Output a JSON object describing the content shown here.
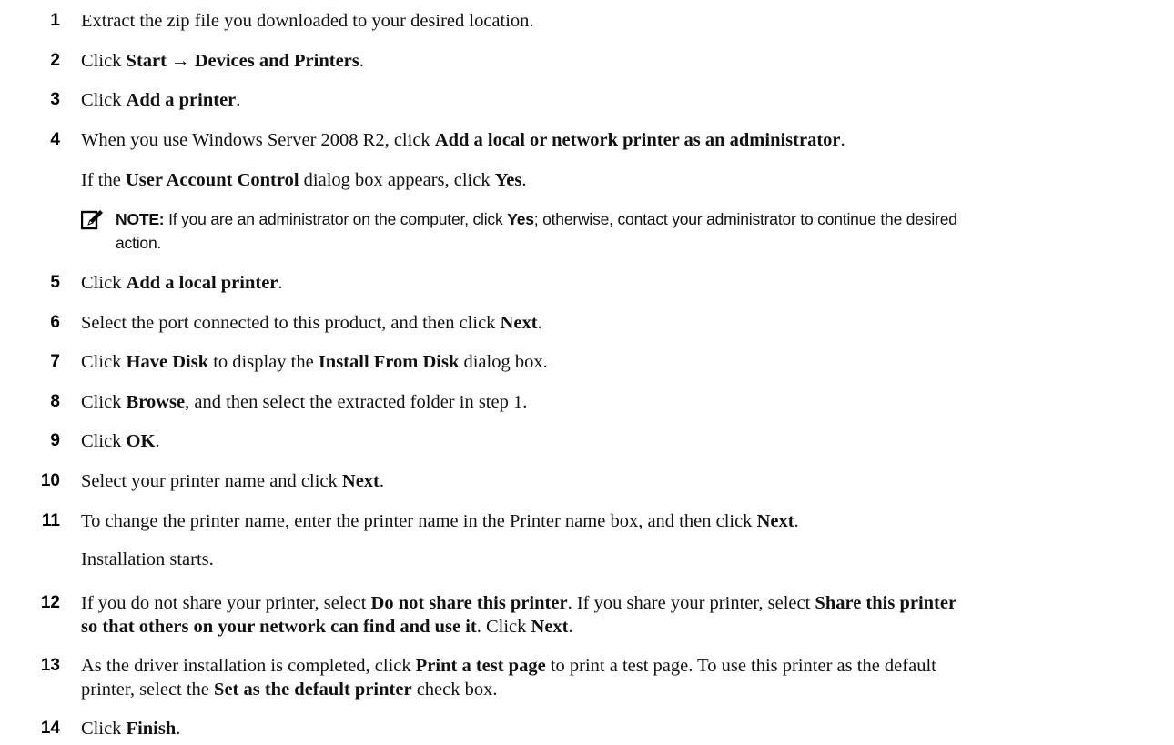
{
  "steps": [
    {
      "n": "1",
      "text": "Extract the zip file you downloaded to your desired location."
    },
    {
      "n": "2",
      "pre": "Click ",
      "b1": "Start → Devices and Printers",
      "post": "."
    },
    {
      "n": "3",
      "pre": "Click ",
      "b1": "Add a printer",
      "post": "."
    },
    {
      "n": "4",
      "pre": "When you use Windows Server 2008 R2, click ",
      "b1": "Add a local or network printer as an administrator",
      "post": ".",
      "sub": {
        "pre": "If the ",
        "b1": "User Account Control",
        "mid": " dialog box appears, click ",
        "b2": "Yes",
        "post": "."
      }
    },
    {
      "n": "5",
      "pre": "Click ",
      "b1": "Add a local printer",
      "post": "."
    },
    {
      "n": "6",
      "pre": "Select the port connected to this product, and then click ",
      "b1": "Next",
      "post": "."
    },
    {
      "n": "7",
      "pre": "Click ",
      "b1": "Have Disk",
      "mid": " to display the ",
      "b2": "Install From Disk",
      "post": " dialog box."
    },
    {
      "n": "8",
      "pre": "Click ",
      "b1": "Browse",
      "post": ", and then select the extracted folder in step 1."
    },
    {
      "n": "9",
      "pre": "Click ",
      "b1": "OK",
      "post": "."
    },
    {
      "n": "10",
      "pre": "Select your printer name and click ",
      "b1": "Next",
      "post": "."
    },
    {
      "n": "11",
      "pre": "To change the printer name, enter the printer name in the Printer name box, and then click ",
      "b1": "Next",
      "post": ".",
      "sub": {
        "pre": "Installation starts."
      }
    },
    {
      "n": "12",
      "pre": "If you do not share your printer, select ",
      "b1": "Do not share this printer",
      "mid": ". If you share your printer, select ",
      "b2": "Share this printer",
      "line2b": "so that others on your network can find and use it",
      "line2mid": ". Click ",
      "line2b2": "Next",
      "post": "."
    },
    {
      "n": "13",
      "pre": "As the driver installation is completed, click ",
      "b1": "Print a test page",
      "mid": " to print a test page. To use this printer as the default",
      "line2pre": "printer, select the ",
      "b2": "Set as the default printer",
      "post": " check box."
    },
    {
      "n": "14",
      "pre": "Click ",
      "b1": "Finish",
      "post": "."
    }
  ],
  "note": {
    "icon": "pencil-note-icon",
    "label": "NOTE:",
    "pre": " If you are an administrator on the computer, click ",
    "bold": "Yes",
    "post": "; otherwise, contact your administrator to continue the desired",
    "line2": "action."
  }
}
